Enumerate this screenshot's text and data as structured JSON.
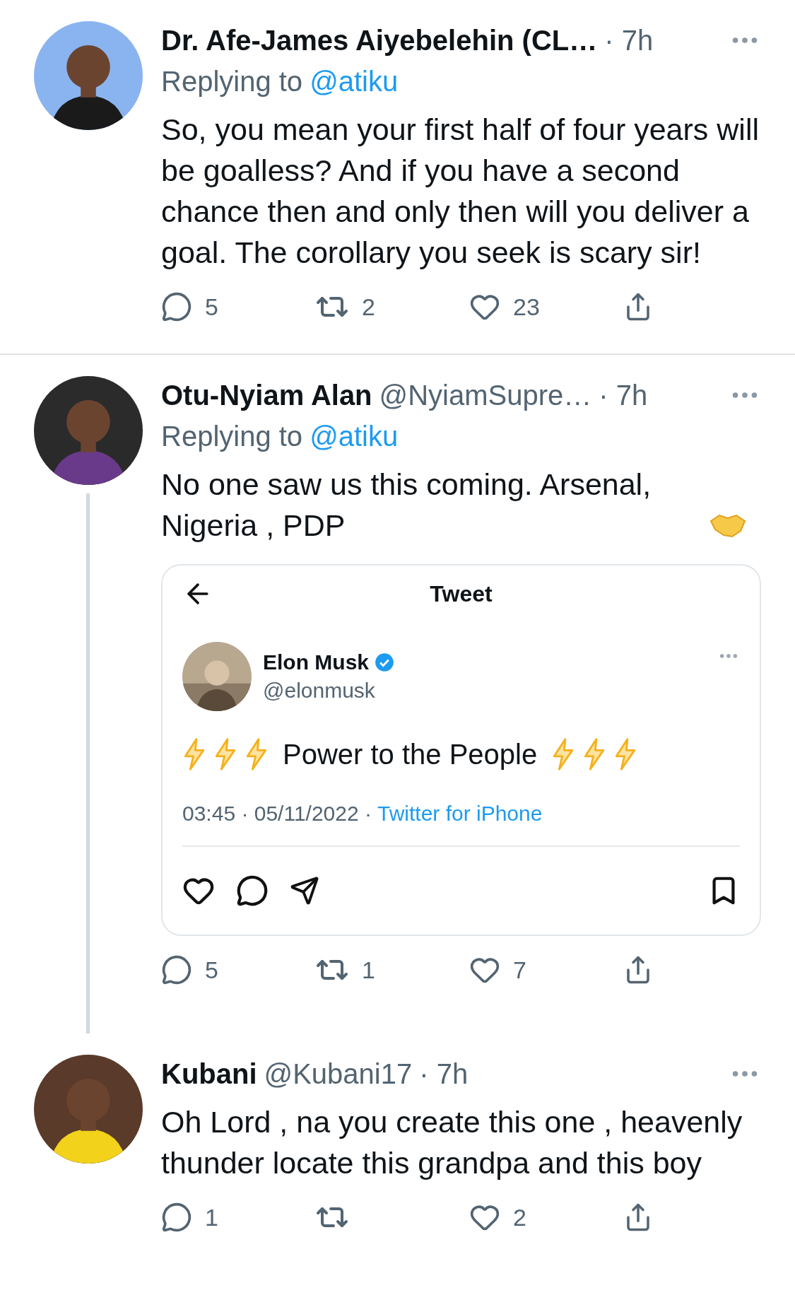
{
  "tweets": [
    {
      "name": "Dr. Afe-James Aiyebelehin (CL…",
      "meta": "· 7h",
      "replying_label": "Replying to",
      "replying_handle": "@atiku",
      "text": "So, you mean your first half of four years will be goalless? And if you have a second chance then and only then will you deliver a goal. The corollary you seek is scary sir!",
      "thread_line": false,
      "replies": "5",
      "retweets": "2",
      "likes": "23"
    },
    {
      "name": "Otu-Nyiam Alan",
      "handle": "@NyiamSupre…",
      "meta": "· 7h",
      "replying_label": "Replying to",
      "replying_handle": "@atiku",
      "text": "No one saw us this coming. Arsenal, Nigeria , PDP",
      "thread_line": true,
      "replies": "5",
      "retweets": "1",
      "likes": "7",
      "embed": {
        "title": "Tweet",
        "name": "Elon Musk",
        "handle": "@elonmusk",
        "text": "Power to the People",
        "timestamp": "03:45 · 05/11/2022 ·",
        "source": "Twitter for iPhone"
      }
    },
    {
      "name": "Kubani",
      "handle": "@Kubani17",
      "meta": "· 7h",
      "text": "Oh Lord , na you create this one , heavenly thunder locate this grandpa and this boy",
      "thread_line": false,
      "replies": "1",
      "likes": "2"
    }
  ]
}
